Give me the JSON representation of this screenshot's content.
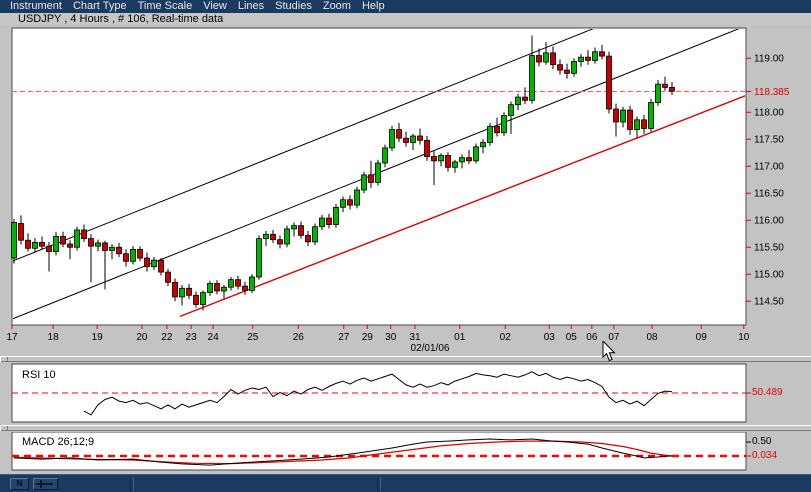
{
  "menu": {
    "items": [
      "Instrument",
      "Chart Type",
      "Time Scale",
      "View",
      "Lines",
      "Studies",
      "Zoom",
      "Help"
    ]
  },
  "title": "USDJPY , 4 Hours , # 106, Real-time data",
  "colors": {
    "chrome_navy": "#1b3a60",
    "chrome_gray": "#c3c3c3",
    "candle_up": "#00b400",
    "candle_down": "#c80000",
    "wick": "#000000",
    "channel_line": "#000000",
    "support_line": "#dd0000",
    "price_line": "#ff5a5a",
    "axis_accent": "#e40000",
    "rsi_line": "#000000",
    "macd_line": "#000000",
    "signal_line": "#dd0000"
  },
  "chart_data": [
    {
      "type": "candlestick",
      "symbol": "USDJPY",
      "interval": "4 Hours",
      "bars_count": 106,
      "feed": "Real-time data",
      "y_axis": {
        "price_top": 119.56,
        "price_bottom": 114.06,
        "ticks": [
          {
            "label": "119.00",
            "value": 119.0
          },
          {
            "label": "118.00",
            "value": 118.0
          },
          {
            "label": "117.50",
            "value": 117.5
          },
          {
            "label": "117.00",
            "value": 117.0
          },
          {
            "label": "116.50",
            "value": 116.5
          },
          {
            "label": "116.00",
            "value": 116.0
          },
          {
            "label": "115.50",
            "value": 115.5
          },
          {
            "label": "115.00",
            "value": 115.0
          },
          {
            "label": "114.50",
            "value": 114.5
          }
        ],
        "current_price": 118.385,
        "current_price_label": "118.385"
      },
      "x_axis": {
        "period_label": "02/01/06",
        "labels": [
          {
            "text": "17",
            "pos": 0.0
          },
          {
            "text": "18",
            "pos": 0.056
          },
          {
            "text": "19",
            "pos": 0.116
          },
          {
            "text": "20",
            "pos": 0.177
          },
          {
            "text": "22",
            "pos": 0.211
          },
          {
            "text": "23",
            "pos": 0.244
          },
          {
            "text": "24",
            "pos": 0.274
          },
          {
            "text": "25",
            "pos": 0.328
          },
          {
            "text": "26",
            "pos": 0.39
          },
          {
            "text": "27",
            "pos": 0.452
          },
          {
            "text": "29",
            "pos": 0.484
          },
          {
            "text": "30",
            "pos": 0.516
          },
          {
            "text": "31",
            "pos": 0.549
          },
          {
            "text": "01",
            "pos": 0.61
          },
          {
            "text": "02",
            "pos": 0.672
          },
          {
            "text": "03",
            "pos": 0.732
          },
          {
            "text": "05",
            "pos": 0.762
          },
          {
            "text": "06",
            "pos": 0.79
          },
          {
            "text": "07",
            "pos": 0.82
          },
          {
            "text": "08",
            "pos": 0.872
          },
          {
            "text": "09",
            "pos": 0.939
          },
          {
            "text": "10",
            "pos": 0.997
          }
        ]
      },
      "trend_lines": [
        {
          "name": "channel-upper-line",
          "x1": 0.0,
          "p1": 115.24,
          "x2": 1.0,
          "p2": 120.68,
          "color": "#000000",
          "width": 1
        },
        {
          "name": "channel-lower-line",
          "x1": 0.0,
          "p1": 114.17,
          "x2": 1.0,
          "p2": 119.6,
          "color": "#000000",
          "width": 1
        },
        {
          "name": "support-trend-line",
          "x1": 0.229,
          "p1": 114.22,
          "x2": 1.0,
          "p2": 118.31,
          "color": "#dd0000",
          "width": 1.4
        }
      ],
      "candles": [
        [
          115.3,
          116.02,
          115.2,
          115.96
        ],
        [
          115.94,
          116.09,
          115.55,
          115.63
        ],
        [
          115.63,
          115.76,
          115.42,
          115.48
        ],
        [
          115.48,
          115.67,
          115.4,
          115.59
        ],
        [
          115.59,
          115.7,
          115.46,
          115.52
        ],
        [
          115.52,
          115.6,
          115.05,
          115.42
        ],
        [
          115.42,
          115.78,
          115.35,
          115.7
        ],
        [
          115.7,
          115.79,
          115.5,
          115.56
        ],
        [
          115.56,
          115.63,
          115.28,
          115.5
        ],
        [
          115.5,
          115.88,
          115.44,
          115.82
        ],
        [
          115.82,
          115.92,
          115.6,
          115.66
        ],
        [
          115.66,
          115.74,
          114.85,
          115.52
        ],
        [
          115.52,
          115.64,
          115.42,
          115.58
        ],
        [
          115.58,
          115.62,
          114.72,
          115.44
        ],
        [
          115.44,
          115.56,
          115.28,
          115.5
        ],
        [
          115.5,
          115.58,
          115.32,
          115.38
        ],
        [
          115.38,
          115.46,
          115.14,
          115.24
        ],
        [
          115.24,
          115.52,
          115.18,
          115.46
        ],
        [
          115.46,
          115.52,
          115.24,
          115.3
        ],
        [
          115.3,
          115.4,
          115.05,
          115.14
        ],
        [
          115.14,
          115.32,
          115.08,
          115.26
        ],
        [
          115.26,
          115.3,
          114.98,
          115.04
        ],
        [
          115.04,
          115.1,
          114.78,
          114.85
        ],
        [
          114.85,
          114.92,
          114.5,
          114.58
        ],
        [
          114.58,
          114.8,
          114.42,
          114.74
        ],
        [
          114.74,
          114.82,
          114.54,
          114.61
        ],
        [
          114.61,
          114.68,
          114.38,
          114.44
        ],
        [
          114.44,
          114.7,
          114.33,
          114.66
        ],
        [
          114.66,
          114.88,
          114.6,
          114.83
        ],
        [
          114.83,
          114.89,
          114.63,
          114.69
        ],
        [
          114.69,
          114.8,
          114.55,
          114.76
        ],
        [
          114.76,
          114.95,
          114.7,
          114.9
        ],
        [
          114.9,
          114.97,
          114.72,
          114.78
        ],
        [
          114.78,
          114.86,
          114.62,
          114.7
        ],
        [
          114.7,
          115.0,
          114.65,
          114.95
        ],
        [
          114.95,
          115.72,
          114.9,
          115.66
        ],
        [
          115.66,
          115.8,
          115.52,
          115.74
        ],
        [
          115.74,
          115.82,
          115.58,
          115.64
        ],
        [
          115.64,
          115.72,
          115.48,
          115.56
        ],
        [
          115.56,
          115.9,
          115.5,
          115.84
        ],
        [
          115.84,
          115.96,
          115.7,
          115.9
        ],
        [
          115.9,
          115.98,
          115.66,
          115.72
        ],
        [
          115.72,
          115.8,
          115.52,
          115.6
        ],
        [
          115.6,
          115.94,
          115.54,
          115.88
        ],
        [
          115.88,
          116.1,
          115.82,
          116.04
        ],
        [
          116.04,
          116.12,
          115.85,
          115.92
        ],
        [
          115.92,
          116.3,
          115.86,
          116.24
        ],
        [
          116.24,
          116.44,
          116.15,
          116.38
        ],
        [
          116.38,
          116.46,
          116.2,
          116.28
        ],
        [
          116.28,
          116.62,
          116.22,
          116.56
        ],
        [
          116.56,
          116.9,
          116.5,
          116.84
        ],
        [
          116.84,
          117.1,
          116.6,
          116.7
        ],
        [
          116.7,
          117.12,
          116.64,
          117.06
        ],
        [
          117.06,
          117.4,
          116.98,
          117.34
        ],
        [
          117.34,
          117.75,
          117.28,
          117.68
        ],
        [
          117.68,
          117.8,
          117.45,
          117.52
        ],
        [
          117.52,
          117.64,
          117.36,
          117.44
        ],
        [
          117.44,
          117.6,
          117.3,
          117.56
        ],
        [
          117.56,
          117.7,
          117.4,
          117.48
        ],
        [
          117.48,
          117.56,
          117.1,
          117.18
        ],
        [
          117.18,
          117.28,
          116.65,
          117.1
        ],
        [
          117.1,
          117.24,
          117.0,
          117.2
        ],
        [
          117.2,
          117.26,
          116.9,
          116.98
        ],
        [
          116.98,
          117.12,
          116.88,
          117.08
        ],
        [
          117.08,
          117.22,
          116.96,
          117.16
        ],
        [
          117.16,
          117.3,
          117.04,
          117.1
        ],
        [
          117.1,
          117.42,
          117.05,
          117.36
        ],
        [
          117.36,
          117.5,
          117.24,
          117.44
        ],
        [
          117.44,
          117.8,
          117.38,
          117.74
        ],
        [
          117.74,
          117.9,
          117.55,
          117.62
        ],
        [
          117.62,
          118.0,
          117.56,
          117.94
        ],
        [
          117.94,
          118.2,
          117.6,
          118.14
        ],
        [
          118.14,
          118.34,
          118.04,
          118.28
        ],
        [
          118.28,
          118.46,
          118.15,
          118.22
        ],
        [
          118.22,
          119.42,
          118.16,
          119.05
        ],
        [
          119.05,
          119.18,
          118.85,
          118.93
        ],
        [
          118.93,
          119.3,
          118.88,
          119.1
        ],
        [
          119.1,
          119.22,
          118.8,
          118.88
        ],
        [
          118.88,
          118.98,
          118.7,
          118.78
        ],
        [
          118.78,
          118.9,
          118.62,
          118.72
        ],
        [
          118.72,
          119.0,
          118.66,
          118.94
        ],
        [
          118.94,
          119.08,
          118.84,
          119.02
        ],
        [
          119.02,
          119.15,
          118.88,
          118.96
        ],
        [
          118.96,
          119.2,
          118.9,
          119.12
        ],
        [
          119.12,
          119.25,
          118.98,
          119.04
        ],
        [
          119.04,
          119.12,
          117.98,
          118.06
        ],
        [
          118.06,
          118.16,
          117.55,
          117.82
        ],
        [
          117.82,
          118.1,
          117.72,
          118.04
        ],
        [
          118.04,
          118.12,
          117.58,
          117.68
        ],
        [
          117.68,
          117.92,
          117.52,
          117.86
        ],
        [
          117.86,
          117.95,
          117.6,
          117.7
        ],
        [
          117.7,
          118.25,
          117.64,
          118.18
        ],
        [
          118.18,
          118.6,
          118.12,
          118.52
        ],
        [
          118.52,
          118.66,
          118.4,
          118.46
        ],
        [
          118.46,
          118.56,
          118.32,
          118.39
        ]
      ]
    },
    {
      "type": "line",
      "title": "RSI 10",
      "current": 50.489,
      "current_label": "50.489",
      "start_index": 10,
      "values": [
        27,
        22,
        35,
        42,
        45,
        40,
        38,
        41,
        36,
        38,
        34,
        30,
        35,
        30,
        36,
        32,
        35,
        38,
        41,
        38,
        46,
        55,
        49,
        54,
        57,
        55,
        58,
        46,
        51,
        47,
        53,
        49,
        55,
        58,
        54,
        59,
        63,
        66,
        62,
        67,
        70,
        66,
        69,
        72,
        75,
        68,
        61,
        58,
        62,
        58,
        60,
        64,
        61,
        66,
        69,
        72,
        76,
        74,
        73,
        71,
        75,
        73,
        71,
        74,
        78,
        73,
        76,
        71,
        68,
        71,
        69,
        66,
        68,
        64,
        59,
        45,
        38,
        41,
        36,
        40,
        34,
        42,
        50,
        53,
        52
      ]
    },
    {
      "type": "line",
      "title": "MACD 26;12;9",
      "upper_label": "0.50",
      "upper_value": 0.5,
      "current_label": "0.034",
      "current": 0.034,
      "macd_points": [
        [
          0,
          -0.03
        ],
        [
          4,
          -0.07
        ],
        [
          8,
          -0.03
        ],
        [
          12,
          -0.1
        ],
        [
          17,
          -0.07
        ],
        [
          21,
          -0.17
        ],
        [
          24,
          -0.23
        ],
        [
          28,
          -0.27
        ],
        [
          32,
          -0.2
        ],
        [
          37,
          -0.13
        ],
        [
          41,
          -0.07
        ],
        [
          45,
          0.0
        ],
        [
          49,
          0.13
        ],
        [
          54,
          0.3
        ],
        [
          57,
          0.43
        ],
        [
          59,
          0.5
        ],
        [
          62,
          0.53
        ],
        [
          65,
          0.57
        ],
        [
          68,
          0.6
        ],
        [
          71,
          0.57
        ],
        [
          74,
          0.6
        ],
        [
          77,
          0.53
        ],
        [
          79,
          0.5
        ],
        [
          82,
          0.43
        ],
        [
          84,
          0.3
        ],
        [
          87,
          0.13
        ],
        [
          89,
          0.03
        ],
        [
          90,
          -0.03
        ],
        [
          92,
          0.0
        ],
        [
          93,
          0.03
        ],
        [
          94,
          0.03
        ]
      ],
      "signal_points": [
        [
          0,
          -0.01
        ],
        [
          5,
          -0.04
        ],
        [
          11,
          -0.08
        ],
        [
          17,
          -0.1
        ],
        [
          22,
          -0.17
        ],
        [
          26,
          -0.21
        ],
        [
          31,
          -0.22
        ],
        [
          35,
          -0.19
        ],
        [
          39,
          -0.15
        ],
        [
          44,
          -0.1
        ],
        [
          48,
          -0.03
        ],
        [
          52,
          0.1
        ],
        [
          57,
          0.25
        ],
        [
          61,
          0.37
        ],
        [
          65,
          0.45
        ],
        [
          69,
          0.5
        ],
        [
          73,
          0.53
        ],
        [
          77,
          0.53
        ],
        [
          81,
          0.5
        ],
        [
          84,
          0.45
        ],
        [
          87,
          0.35
        ],
        [
          89,
          0.25
        ],
        [
          91,
          0.13
        ],
        [
          93,
          0.06
        ],
        [
          94,
          0.04
        ]
      ]
    }
  ],
  "status_bar": {
    "buttons": [
      {
        "name": "pointer-tool-button",
        "glyph": "N"
      },
      {
        "name": "line-tool-button",
        "glyph": "line"
      }
    ]
  }
}
